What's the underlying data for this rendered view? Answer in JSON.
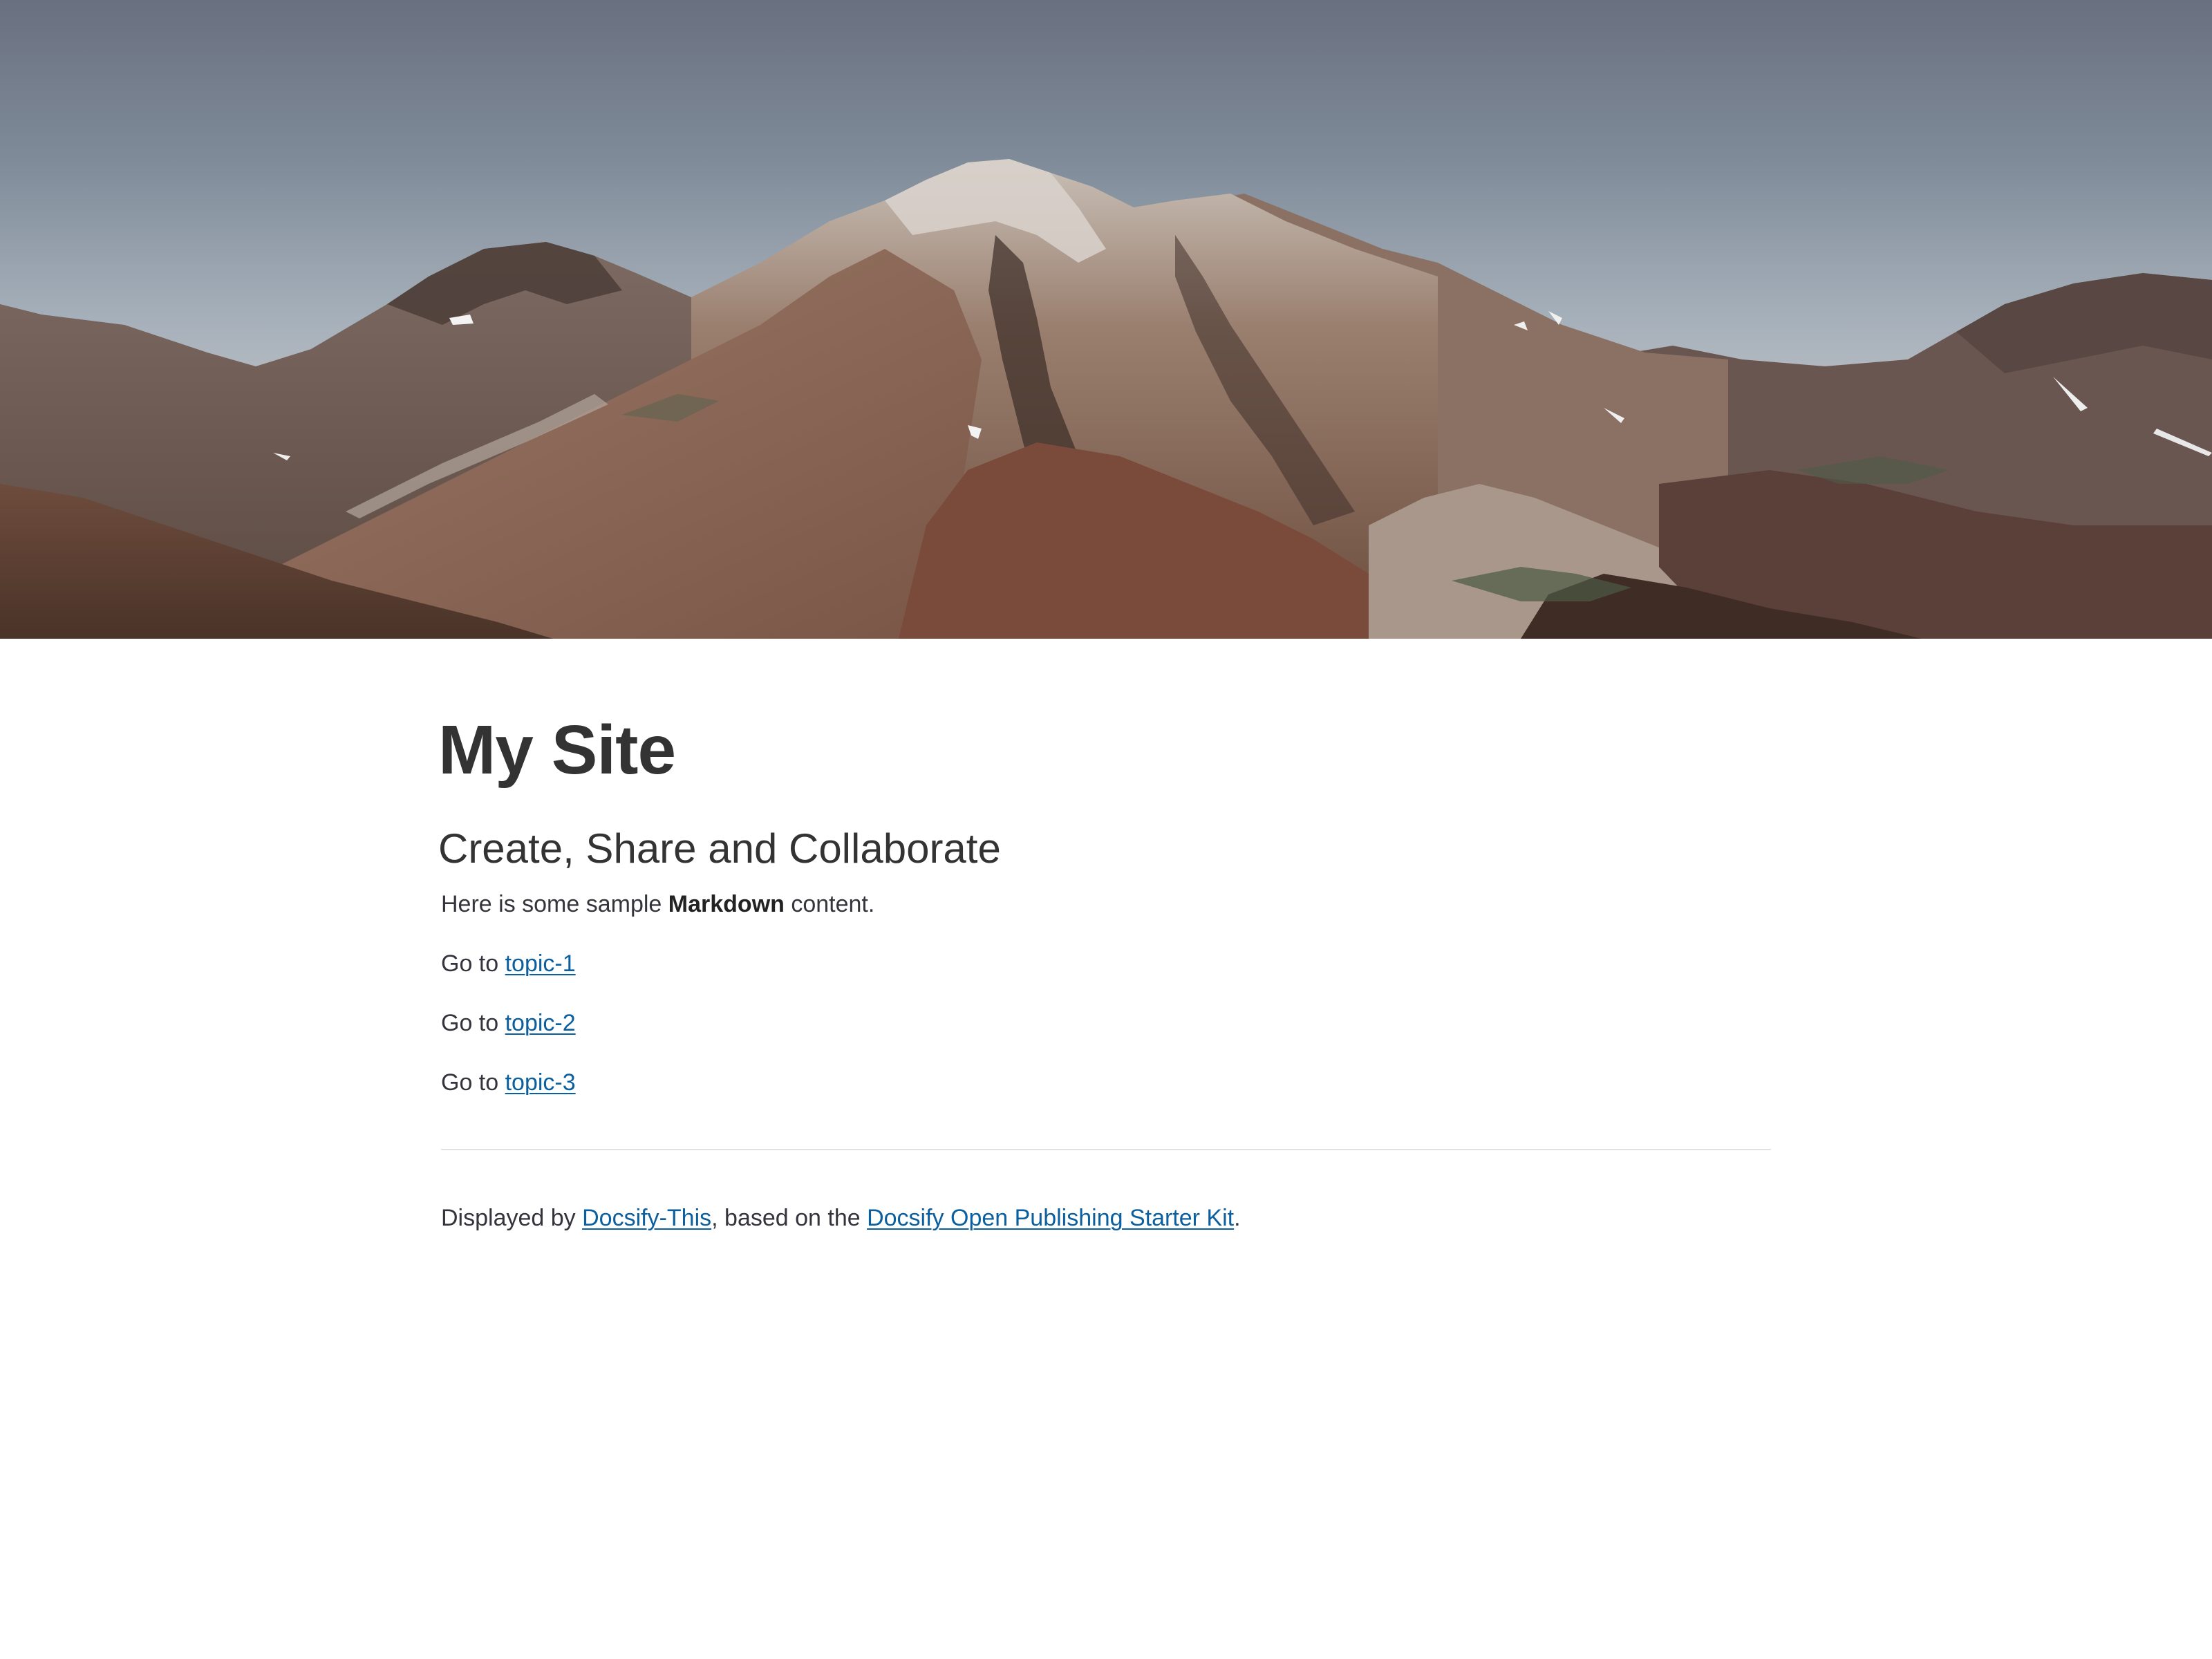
{
  "hero": {
    "image_alt": "mountain-landscape",
    "sky_color": "#7d8a99",
    "mountain_color": "#7a5a4a"
  },
  "main": {
    "title": "My Site",
    "subtitle": "Create, Share and Collaborate",
    "intro": {
      "before": "Here is some sample ",
      "bold": "Markdown",
      "after": " content."
    },
    "topics": [
      {
        "prefix": "Go to ",
        "link": "topic-1"
      },
      {
        "prefix": "Go to ",
        "link": "topic-2"
      },
      {
        "prefix": "Go to ",
        "link": "topic-3"
      }
    ]
  },
  "footer": {
    "prefix": "Displayed by ",
    "link1": "Docsify-This",
    "middle": ", based on the ",
    "link2": "Docsify Open Publishing Starter Kit",
    "suffix": "."
  },
  "colors": {
    "text": "#34343c",
    "link": "#0b5f9e",
    "divider": "#e2e2e2"
  }
}
